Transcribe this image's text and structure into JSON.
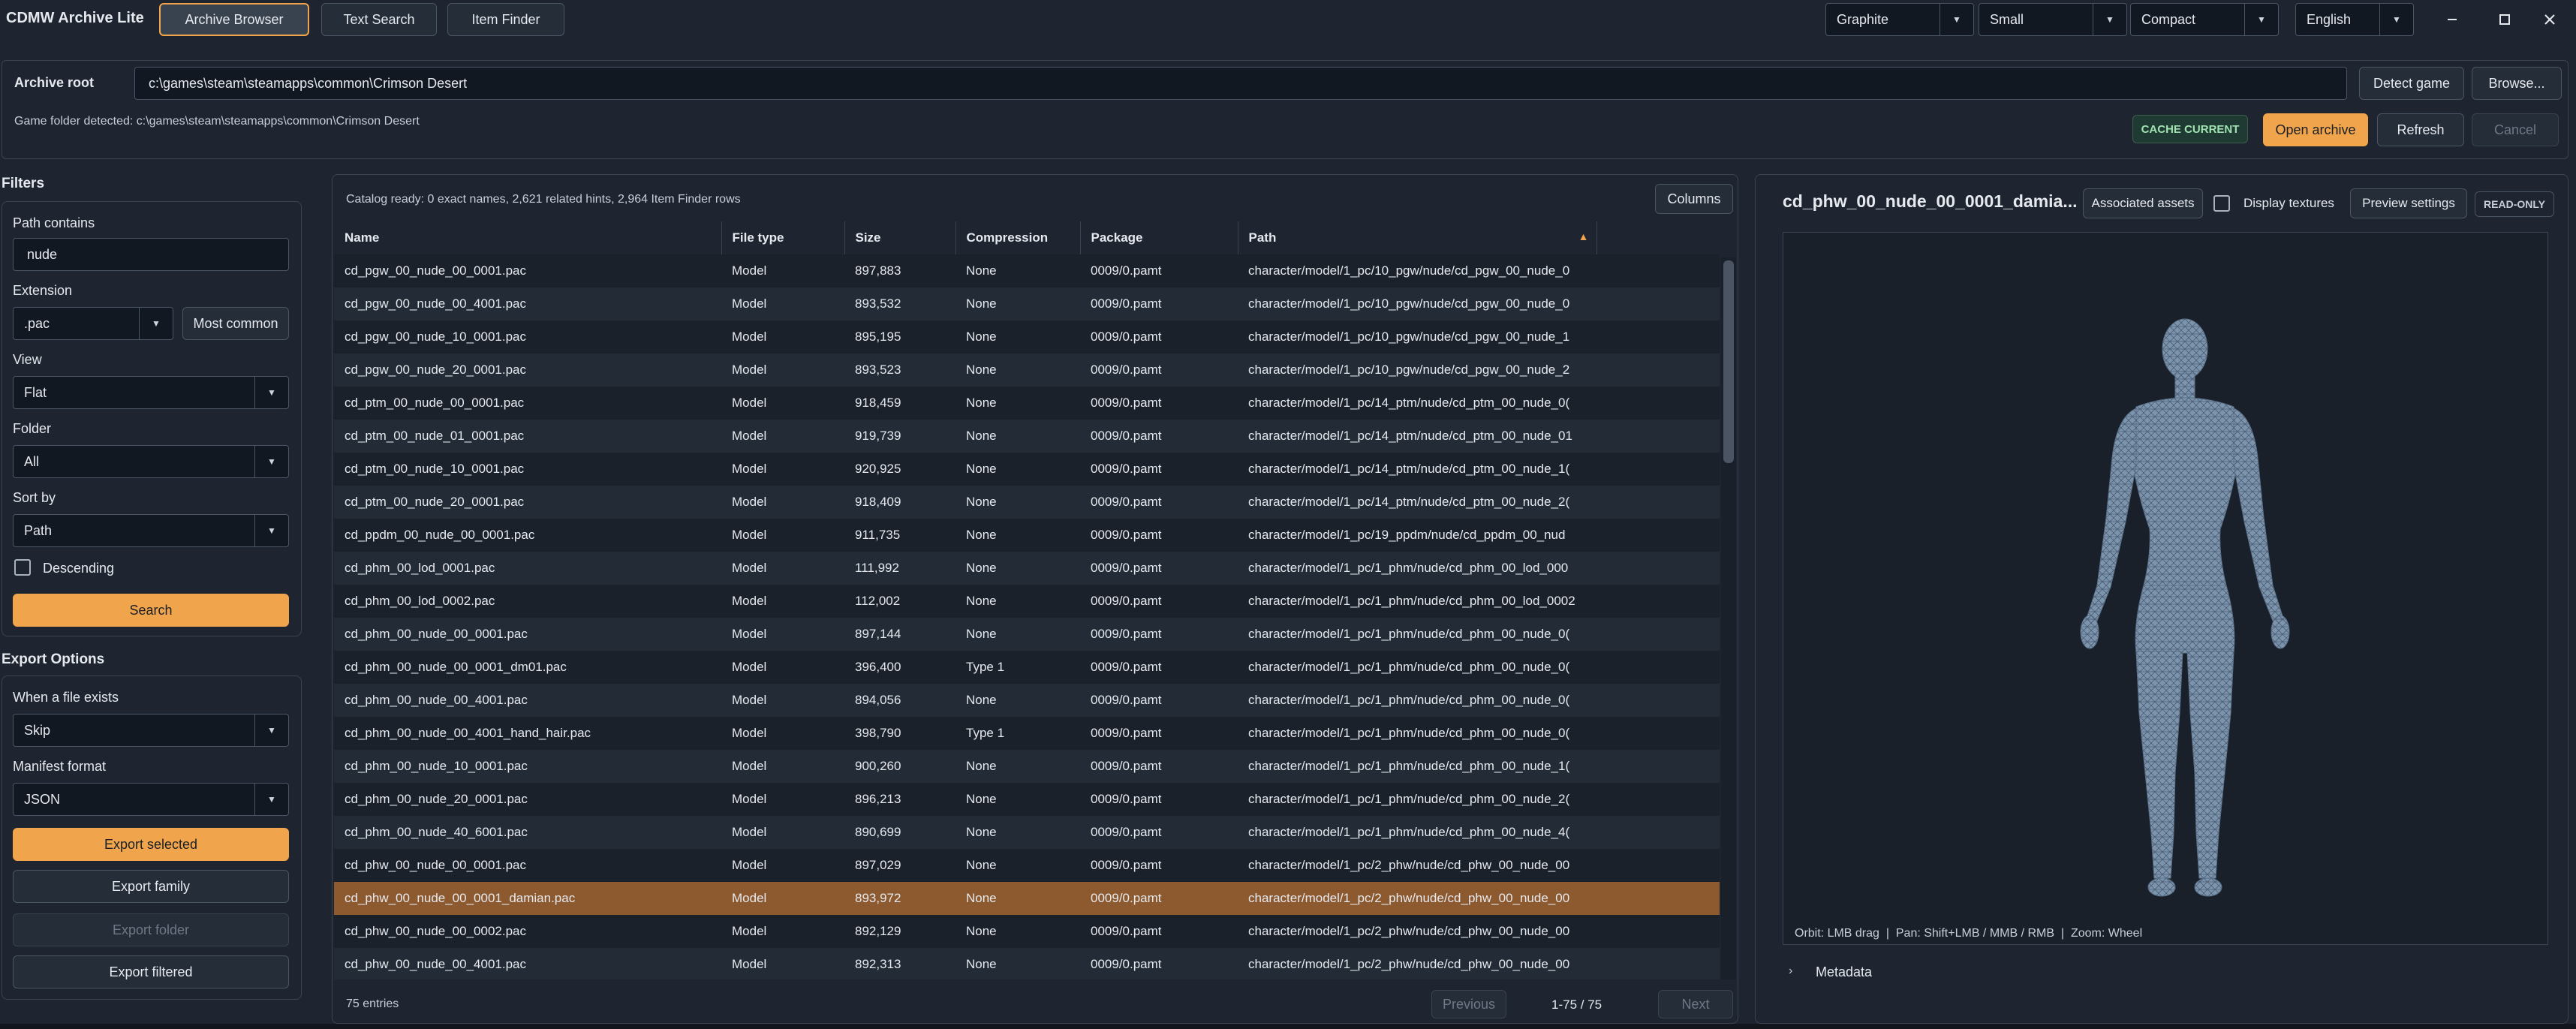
{
  "app": {
    "title": "CDMW Archive Lite"
  },
  "tabs": [
    {
      "label": "Archive Browser",
      "active": true
    },
    {
      "label": "Text Search",
      "active": false
    },
    {
      "label": "Item Finder",
      "active": false
    }
  ],
  "topbar": {
    "theme": "Graphite",
    "size": "Small",
    "density": "Compact",
    "language": "English"
  },
  "window": {
    "minimize_icon": "minimize-icon",
    "maximize_icon": "maximize-icon",
    "close_icon": "close-icon"
  },
  "archive": {
    "root_label": "Archive root",
    "root_value": "c:\\games\\steam\\steamapps\\common\\Crimson Desert",
    "detect_button": "Detect game",
    "browse_button": "Browse...",
    "detected_text": "Game folder detected: c:\\games\\steam\\steamapps\\common\\Crimson Desert",
    "cache_badge": "CACHE CURRENT",
    "open_button": "Open archive",
    "refresh_button": "Refresh",
    "cancel_button": "Cancel"
  },
  "filters": {
    "title": "Filters",
    "path_label": "Path contains",
    "path_value": "nude",
    "extension_label": "Extension",
    "extension_value": ".pac",
    "most_common_button": "Most common",
    "view_label": "View",
    "view_value": "Flat",
    "folder_label": "Folder",
    "folder_value": "All",
    "sort_label": "Sort by",
    "sort_value": "Path",
    "descending_label": "Descending",
    "search_button": "Search"
  },
  "export": {
    "title": "Export Options",
    "exists_label": "When a file exists",
    "exists_value": "Skip",
    "manifest_label": "Manifest format",
    "manifest_value": "JSON",
    "selected_button": "Export selected",
    "family_button": "Export family",
    "folder_button": "Export folder",
    "filtered_button": "Export filtered"
  },
  "catalog": {
    "status": "Catalog ready: 0 exact names, 2,621 related hints, 2,964 Item Finder rows",
    "columns_button": "Columns",
    "headers": [
      "Name",
      "File type",
      "Size",
      "Compression",
      "Package",
      "Path"
    ],
    "sort_indicator": "▲",
    "rows": [
      [
        "cd_pgw_00_nude_00_0001.pac",
        "Model",
        "897,883",
        "None",
        "0009/0.pamt",
        "character/model/1_pc/10_pgw/nude/cd_pgw_00_nude_0"
      ],
      [
        "cd_pgw_00_nude_00_4001.pac",
        "Model",
        "893,532",
        "None",
        "0009/0.pamt",
        "character/model/1_pc/10_pgw/nude/cd_pgw_00_nude_0"
      ],
      [
        "cd_pgw_00_nude_10_0001.pac",
        "Model",
        "895,195",
        "None",
        "0009/0.pamt",
        "character/model/1_pc/10_pgw/nude/cd_pgw_00_nude_1"
      ],
      [
        "cd_pgw_00_nude_20_0001.pac",
        "Model",
        "893,523",
        "None",
        "0009/0.pamt",
        "character/model/1_pc/10_pgw/nude/cd_pgw_00_nude_2"
      ],
      [
        "cd_ptm_00_nude_00_0001.pac",
        "Model",
        "918,459",
        "None",
        "0009/0.pamt",
        "character/model/1_pc/14_ptm/nude/cd_ptm_00_nude_0("
      ],
      [
        "cd_ptm_00_nude_01_0001.pac",
        "Model",
        "919,739",
        "None",
        "0009/0.pamt",
        "character/model/1_pc/14_ptm/nude/cd_ptm_00_nude_01"
      ],
      [
        "cd_ptm_00_nude_10_0001.pac",
        "Model",
        "920,925",
        "None",
        "0009/0.pamt",
        "character/model/1_pc/14_ptm/nude/cd_ptm_00_nude_1("
      ],
      [
        "cd_ptm_00_nude_20_0001.pac",
        "Model",
        "918,409",
        "None",
        "0009/0.pamt",
        "character/model/1_pc/14_ptm/nude/cd_ptm_00_nude_2("
      ],
      [
        "cd_ppdm_00_nude_00_0001.pac",
        "Model",
        "911,735",
        "None",
        "0009/0.pamt",
        "character/model/1_pc/19_ppdm/nude/cd_ppdm_00_nud"
      ],
      [
        "cd_phm_00_lod_0001.pac",
        "Model",
        "111,992",
        "None",
        "0009/0.pamt",
        "character/model/1_pc/1_phm/nude/cd_phm_00_lod_000"
      ],
      [
        "cd_phm_00_lod_0002.pac",
        "Model",
        "112,002",
        "None",
        "0009/0.pamt",
        "character/model/1_pc/1_phm/nude/cd_phm_00_lod_0002"
      ],
      [
        "cd_phm_00_nude_00_0001.pac",
        "Model",
        "897,144",
        "None",
        "0009/0.pamt",
        "character/model/1_pc/1_phm/nude/cd_phm_00_nude_0("
      ],
      [
        "cd_phm_00_nude_00_0001_dm01.pac",
        "Model",
        "396,400",
        "Type 1",
        "0009/0.pamt",
        "character/model/1_pc/1_phm/nude/cd_phm_00_nude_0("
      ],
      [
        "cd_phm_00_nude_00_4001.pac",
        "Model",
        "894,056",
        "None",
        "0009/0.pamt",
        "character/model/1_pc/1_phm/nude/cd_phm_00_nude_0("
      ],
      [
        "cd_phm_00_nude_00_4001_hand_hair.pac",
        "Model",
        "398,790",
        "Type 1",
        "0009/0.pamt",
        "character/model/1_pc/1_phm/nude/cd_phm_00_nude_0("
      ],
      [
        "cd_phm_00_nude_10_0001.pac",
        "Model",
        "900,260",
        "None",
        "0009/0.pamt",
        "character/model/1_pc/1_phm/nude/cd_phm_00_nude_1("
      ],
      [
        "cd_phm_00_nude_20_0001.pac",
        "Model",
        "896,213",
        "None",
        "0009/0.pamt",
        "character/model/1_pc/1_phm/nude/cd_phm_00_nude_2("
      ],
      [
        "cd_phm_00_nude_40_6001.pac",
        "Model",
        "890,699",
        "None",
        "0009/0.pamt",
        "character/model/1_pc/1_phm/nude/cd_phm_00_nude_4("
      ],
      [
        "cd_phw_00_nude_00_0001.pac",
        "Model",
        "897,029",
        "None",
        "0009/0.pamt",
        "character/model/1_pc/2_phw/nude/cd_phw_00_nude_00"
      ],
      [
        "cd_phw_00_nude_00_0001_damian.pac",
        "Model",
        "893,972",
        "None",
        "0009/0.pamt",
        "character/model/1_pc/2_phw/nude/cd_phw_00_nude_00"
      ],
      [
        "cd_phw_00_nude_00_0002.pac",
        "Model",
        "892,129",
        "None",
        "0009/0.pamt",
        "character/model/1_pc/2_phw/nude/cd_phw_00_nude_00"
      ],
      [
        "cd_phw_00_nude_00_4001.pac",
        "Model",
        "892,313",
        "None",
        "0009/0.pamt",
        "character/model/1_pc/2_phw/nude/cd_phw_00_nude_00"
      ]
    ],
    "selected_row": 19,
    "entries": "75 entries",
    "previous_button": "Previous",
    "page_info": "1-75 / 75",
    "next_button": "Next"
  },
  "preview": {
    "title": "cd_phw_00_nude_00_0001_damia...",
    "associated_button": "Associated assets",
    "display_textures_label": "Display textures",
    "preview_settings_button": "Preview settings",
    "readonly_badge": "READ-ONLY",
    "controls_hint": "Orbit: LMB drag  |  Pan: Shift+LMB / MMB / RMB  |  Zoom: Wheel",
    "metadata_label": "Metadata",
    "model_color": "#7d94ad"
  },
  "colors": {
    "accent": "#f0a44b",
    "badge_green": "#9fe3b0",
    "selected_row": "#8d5a30"
  }
}
